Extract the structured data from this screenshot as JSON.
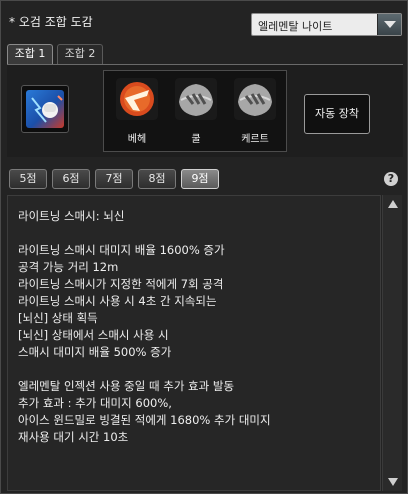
{
  "title": "* 오검 조합 도감",
  "dropdown": {
    "value": "엘레멘탈 나이트"
  },
  "tabs": [
    {
      "label": "조합 1",
      "active": true
    },
    {
      "label": "조합 2",
      "active": false
    }
  ],
  "slots": [
    {
      "label": "베헤",
      "icon": "red-slash-gem-icon"
    },
    {
      "label": "쿨",
      "icon": "gray-claw-stone-icon"
    },
    {
      "label": "케르트",
      "icon": "gray-claw-stone-icon"
    }
  ],
  "auto_button": "자동 장착",
  "point_buttons": [
    "5점",
    "6점",
    "7점",
    "8점",
    "9점"
  ],
  "active_point_index": 4,
  "help_icon": "?",
  "description": [
    "라이트닝 스매시: 뇌신",
    "",
    "라이트닝 스매시 대미지 배율 1600% 증가",
    "공격 가능 거리 12m",
    "라이트닝 스매시가 지정한 적에게 7회 공격",
    "라이트닝 스매시 사용 시 4초 간 지속되는",
    "[뇌신] 상태 획득",
    "[뇌신] 상태에서 스매시 사용 시",
    "스매시 대미지 배율 500% 증가",
    "",
    "엘레멘탈 인젝션 사용 중일 때 추가 효과 발동",
    "추가 효과 : 추가 대미지 600%,",
    "아이스 윈드밀로 빙결된 적에게 1680% 추가 대미지",
    "재사용 대기 시간 10초"
  ],
  "colors": {
    "background": "#232323",
    "slot_red": "#d4401a",
    "slot_gray": "#9a9a9a"
  }
}
